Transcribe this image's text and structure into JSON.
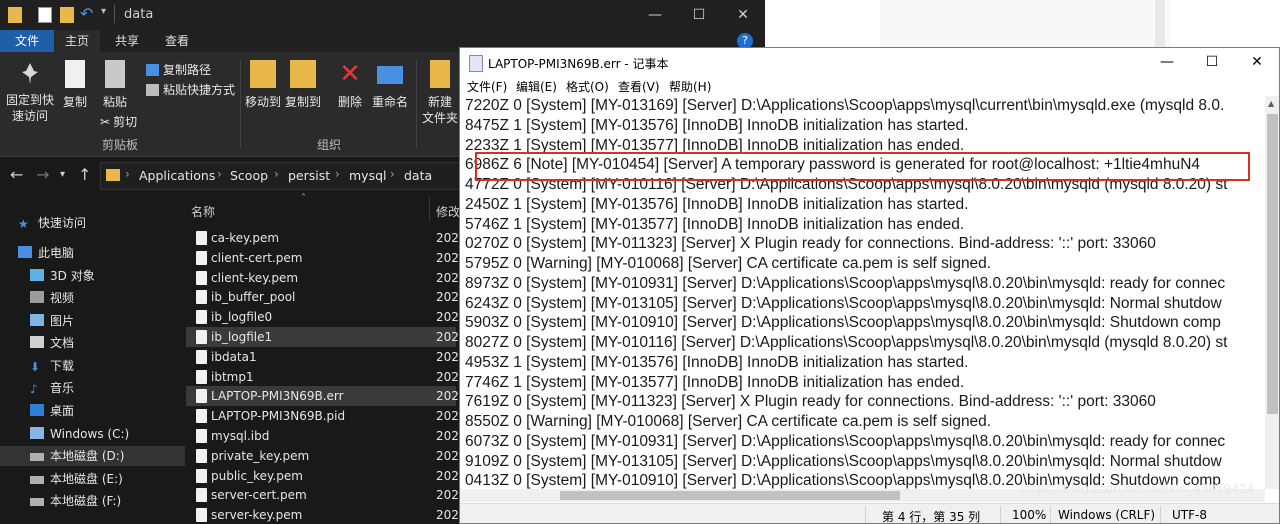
{
  "explorer": {
    "title": "data",
    "window_controls": {
      "minimize": "—",
      "maximize": "☐",
      "close": "✕"
    },
    "tabs": [
      {
        "label": "文件"
      },
      {
        "label": "主页"
      },
      {
        "label": "共享"
      },
      {
        "label": "查看"
      }
    ],
    "ribbon": {
      "pin_label": "固定到快速访问",
      "copy_label": "复制",
      "paste_label": "粘贴",
      "copy_path_label": "复制路径",
      "paste_shortcut_label": "粘贴快捷方式",
      "cut_label": "剪切",
      "move_to_label": "移动到",
      "copy_to_label": "复制到",
      "delete_label": "删除",
      "rename_label": "重命名",
      "new_label": "新建",
      "new_folder_label": "文件夹",
      "clipboard_group": "剪贴板",
      "organize_group": "组织"
    },
    "breadcrumb": [
      "Applications",
      "Scoop",
      "persist",
      "mysql",
      "data"
    ],
    "nav": [
      {
        "label": "快速访问"
      },
      {
        "label": "此电脑"
      },
      {
        "label": "3D 对象"
      },
      {
        "label": "视频"
      },
      {
        "label": "图片"
      },
      {
        "label": "文档"
      },
      {
        "label": "下载"
      },
      {
        "label": "音乐"
      },
      {
        "label": "桌面"
      },
      {
        "label": "Windows (C:)"
      },
      {
        "label": "本地磁盘 (D:)"
      },
      {
        "label": "本地磁盘 (E:)"
      },
      {
        "label": "本地磁盘 (F:)"
      }
    ],
    "columns": {
      "name": "名称",
      "modified": "修改"
    },
    "files": [
      {
        "name": "ca-key.pem",
        "date": "202"
      },
      {
        "name": "client-cert.pem",
        "date": "202"
      },
      {
        "name": "client-key.pem",
        "date": "202"
      },
      {
        "name": "ib_buffer_pool",
        "date": "202"
      },
      {
        "name": "ib_logfile0",
        "date": "202"
      },
      {
        "name": "ib_logfile1",
        "date": "202"
      },
      {
        "name": "ibdata1",
        "date": "202"
      },
      {
        "name": "ibtmp1",
        "date": "202"
      },
      {
        "name": "LAPTOP-PMI3N69B.err",
        "date": "202"
      },
      {
        "name": "LAPTOP-PMI3N69B.pid",
        "date": "202"
      },
      {
        "name": "mysql.ibd",
        "date": "202"
      },
      {
        "name": "private_key.pem",
        "date": "202"
      },
      {
        "name": "public_key.pem",
        "date": "202"
      },
      {
        "name": "server-cert.pem",
        "date": "202"
      },
      {
        "name": "server-key.pem",
        "date": "202"
      }
    ]
  },
  "notepad": {
    "title": "LAPTOP-PMI3N69B.err - 记事本",
    "window_controls": {
      "minimize": "—",
      "maximize": "☐",
      "close": "✕"
    },
    "menus": [
      {
        "label": "文件(F)"
      },
      {
        "label": "编辑(E)"
      },
      {
        "label": "格式(O)"
      },
      {
        "label": "查看(V)"
      },
      {
        "label": "帮助(H)"
      }
    ],
    "lines": [
      "7220Z 0 [System] [MY-013169] [Server] D:\\Applications\\Scoop\\apps\\mysql\\current\\bin\\mysqld.exe (mysqld 8.0.",
      "8475Z 1 [System] [MY-013576] [InnoDB] InnoDB initialization has started.",
      "2233Z 1 [System] [MY-013577] [InnoDB] InnoDB initialization has ended.",
      "6986Z 6 [Note] [MY-010454] [Server] A temporary password is generated for root@localhost: +1ltie4mhuN4",
      "4772Z 0 [System] [MY-010116] [Server] D:\\Applications\\Scoop\\apps\\mysql\\8.0.20\\bin\\mysqld (mysqld 8.0.20) st",
      "2450Z 1 [System] [MY-013576] [InnoDB] InnoDB initialization has started.",
      "5746Z 1 [System] [MY-013577] [InnoDB] InnoDB initialization has ended.",
      "0270Z 0 [System] [MY-011323] [Server] X Plugin ready for connections. Bind-address: '::' port: 33060",
      "5795Z 0 [Warning] [MY-010068] [Server] CA certificate ca.pem is self signed.",
      "8973Z 0 [System] [MY-010931] [Server] D:\\Applications\\Scoop\\apps\\mysql\\8.0.20\\bin\\mysqld: ready for connec",
      "6243Z 0 [System] [MY-013105] [Server] D:\\Applications\\Scoop\\apps\\mysql\\8.0.20\\bin\\mysqld: Normal shutdow",
      "5903Z 0 [System] [MY-010910] [Server] D:\\Applications\\Scoop\\apps\\mysql\\8.0.20\\bin\\mysqld: Shutdown comp",
      "8027Z 0 [System] [MY-010116] [Server] D:\\Applications\\Scoop\\apps\\mysql\\8.0.20\\bin\\mysqld (mysqld 8.0.20) st",
      "4953Z 1 [System] [MY-013576] [InnoDB] InnoDB initialization has started.",
      "7746Z 1 [System] [MY-013577] [InnoDB] InnoDB initialization has ended.",
      "7619Z 0 [System] [MY-011323] [Server] X Plugin ready for connections. Bind-address: '::' port: 33060",
      "8550Z 0 [Warning] [MY-010068] [Server] CA certificate ca.pem is self signed.",
      "6073Z 0 [System] [MY-010931] [Server] D:\\Applications\\Scoop\\apps\\mysql\\8.0.20\\bin\\mysqld: ready for connec",
      "9109Z 0 [System] [MY-013105] [Server] D:\\Applications\\Scoop\\apps\\mysql\\8.0.20\\bin\\mysqld: Normal shutdow",
      "0413Z 0 [System] [MY-010910] [Server] D:\\Applications\\Scoop\\apps\\mysql\\8.0.20\\bin\\mysqld: Shutdown comp"
    ],
    "status": {
      "position": "第 4 行，第 35 列",
      "zoom": "100%",
      "line_ending": "Windows (CRLF)",
      "encoding": "UTF-8"
    },
    "watermark": "https://blog.csdn.net/weixin_43859424"
  },
  "colors": {
    "highlight_border": "#d93025",
    "file_tab": "#1f5fa8",
    "explorer_bg": "#191919"
  }
}
